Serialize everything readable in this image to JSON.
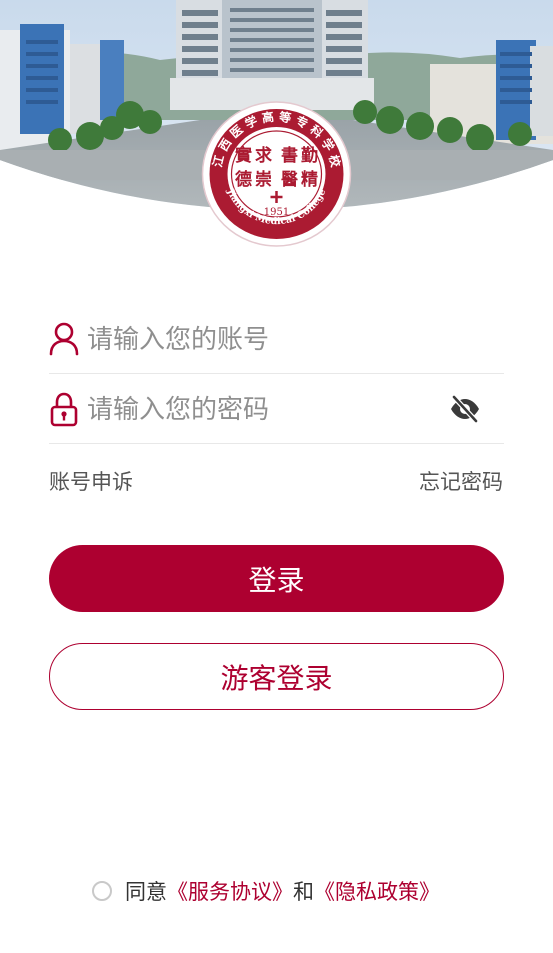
{
  "header": {
    "logo": {
      "name_text": "江西医学高等专科学校",
      "motto": "實求 書勤 德崇 醫精",
      "year": "1951",
      "english": "Jiangxi Medical College"
    }
  },
  "form": {
    "account": {
      "placeholder": "请输入您的账号",
      "value": "",
      "icon": "user-icon"
    },
    "password": {
      "placeholder": "请输入您的密码",
      "value": "",
      "icon": "lock-icon",
      "toggle_icon": "eye-off-icon"
    },
    "appeal_label": "账号申诉",
    "forgot_label": "忘记密码",
    "login_label": "登录",
    "guest_label": "游客登录"
  },
  "agreement": {
    "checked": false,
    "prefix": "同意",
    "service_link": "《服务协议》",
    "conjunction": "和",
    "privacy_link": "《隐私政策》"
  },
  "colors": {
    "brand": "#ad0030",
    "placeholder": "#8f8f8f",
    "divider": "#e8e8e8"
  }
}
